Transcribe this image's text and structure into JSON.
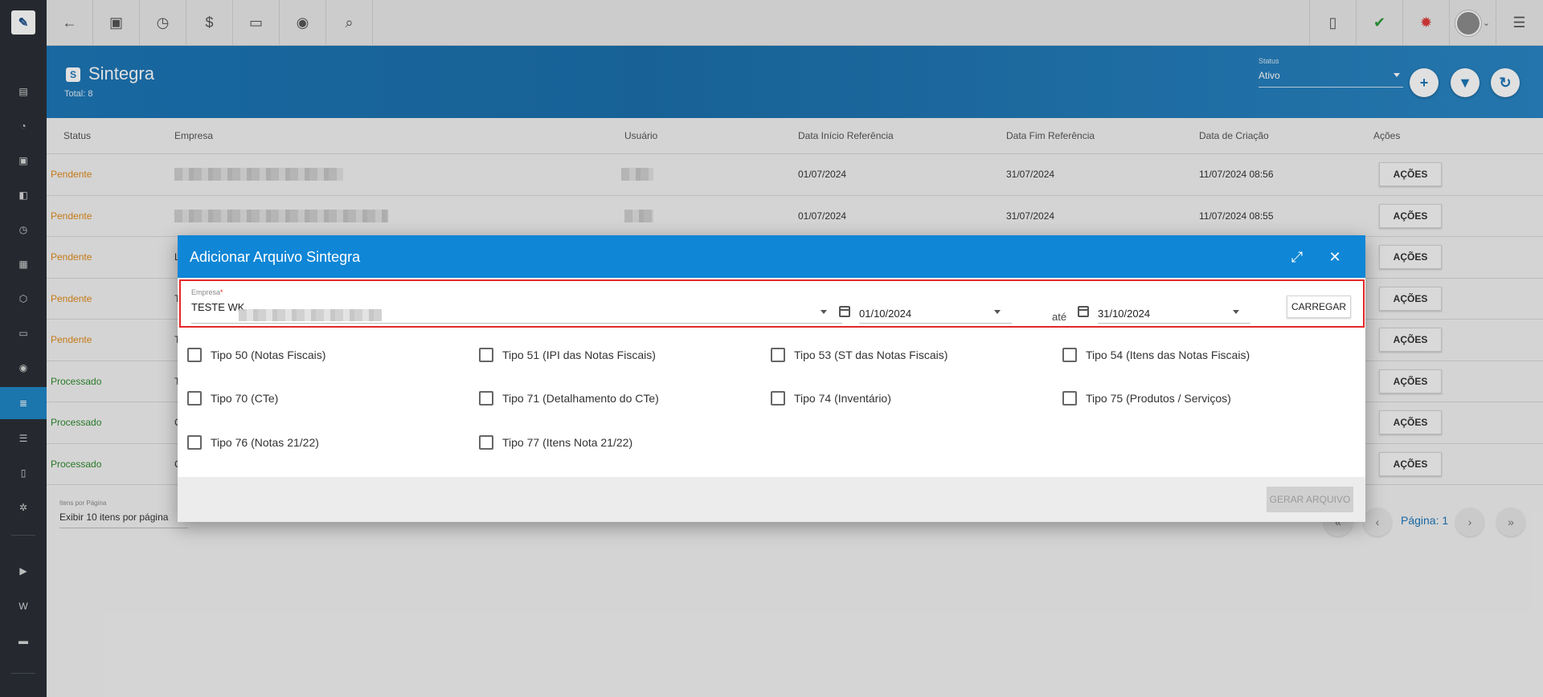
{
  "sidebar": {
    "logo": "✎",
    "items": [
      {
        "icon": "dashboard-icon",
        "glyph": "▤"
      },
      {
        "icon": "chart-icon",
        "glyph": "◔"
      },
      {
        "icon": "contacts-icon",
        "glyph": "▣"
      },
      {
        "icon": "board-icon",
        "glyph": "◧"
      },
      {
        "icon": "calendar-clock-icon",
        "glyph": "◷"
      },
      {
        "icon": "briefcase-icon",
        "glyph": "▦"
      },
      {
        "icon": "box-icon",
        "glyph": "⬡"
      },
      {
        "icon": "money-icon",
        "glyph": "▭"
      },
      {
        "icon": "location-icon",
        "glyph": "◉"
      },
      {
        "icon": "document-icon",
        "glyph": "≣"
      },
      {
        "icon": "stack-icon",
        "glyph": "☰"
      },
      {
        "icon": "file-icon",
        "glyph": "▯"
      },
      {
        "icon": "settings-icon",
        "glyph": "✲"
      },
      {
        "icon": "video-icon",
        "glyph": "▶"
      },
      {
        "icon": "wiki-icon",
        "glyph": "W"
      },
      {
        "icon": "chat-icon",
        "glyph": "▬"
      }
    ]
  },
  "topbar": {
    "back": "←",
    "contacts": "▣",
    "calendar": "◷",
    "money": "$",
    "terminal": "▭",
    "eye": "◉",
    "search": "⌕",
    "pdf": "▯",
    "check": "✔",
    "bell": "✹",
    "menu": "☰",
    "avatar_caret": "⌄"
  },
  "header": {
    "title_icon": "S",
    "title": "Sintegra",
    "total": "Total: 8",
    "status_label": "Status",
    "status_value": "Ativo",
    "add": "+",
    "filter": "▼",
    "refresh": "↻"
  },
  "table": {
    "columns": [
      "Status",
      "Empresa",
      "Usuário",
      "Data Início Referência",
      "Data Fim Referência",
      "Data de Criação",
      "Ações"
    ],
    "rows": [
      {
        "status": "Pendente",
        "kind": "pend",
        "inicio": "01/07/2024",
        "fim": "31/07/2024",
        "criacao": "11/07/2024 08:56",
        "acao": "AÇÕES",
        "empresa_prefix": ""
      },
      {
        "status": "Pendente",
        "kind": "pend",
        "inicio": "01/07/2024",
        "fim": "31/07/2024",
        "criacao": "11/07/2024 08:55",
        "acao": "AÇÕES",
        "empresa_prefix": ""
      },
      {
        "status": "Pendente",
        "kind": "pend",
        "inicio": "",
        "fim": "",
        "criacao": "",
        "acao": "AÇÕES",
        "empresa_prefix": "L"
      },
      {
        "status": "Pendente",
        "kind": "pend",
        "inicio": "",
        "fim": "",
        "criacao": "",
        "acao": "AÇÕES",
        "empresa_prefix": "T"
      },
      {
        "status": "Pendente",
        "kind": "pend",
        "inicio": "",
        "fim": "",
        "criacao": "",
        "acao": "AÇÕES",
        "empresa_prefix": "T"
      },
      {
        "status": "Processado",
        "kind": "proc",
        "inicio": "",
        "fim": "",
        "criacao": "",
        "acao": "AÇÕES",
        "empresa_prefix": "T"
      },
      {
        "status": "Processado",
        "kind": "proc",
        "inicio": "",
        "fim": "",
        "criacao": "",
        "acao": "AÇÕES",
        "empresa_prefix": "C"
      },
      {
        "status": "Processado",
        "kind": "proc",
        "inicio": "",
        "fim": "",
        "criacao": "",
        "acao": "AÇÕES",
        "empresa_prefix": "C"
      }
    ]
  },
  "pagination": {
    "per_page_label": "Itens por Página",
    "per_page_value": "Exibir 10 itens por página",
    "first": "«",
    "prev": "‹",
    "page_text": "Página: 1",
    "next": "›",
    "last": "»"
  },
  "modal": {
    "title": "Adicionar Arquivo Sintegra",
    "expand": "⤢",
    "close": "✕",
    "empresa_label": "Empresa",
    "empresa_required": "*",
    "empresa_value": "TESTE WK",
    "date_start": "01/10/2024",
    "ate": "até",
    "date_end": "31/10/2024",
    "carregar": "CARREGAR",
    "checkboxes": [
      "Tipo 50 (Notas Fiscais)",
      "Tipo 51 (IPI das Notas Fiscais)",
      "Tipo 53 (ST das Notas Fiscais)",
      "Tipo 54 (Itens das Notas Fiscais)",
      "Tipo 70 (CTe)",
      "Tipo 71 (Detalhamento do CTe)",
      "Tipo 74 (Inventário)",
      "Tipo 75 (Produtos / Serviços)",
      "Tipo 76 (Notas 21/22)",
      "Tipo 77 (Itens Nota 21/22)"
    ],
    "gerar": "GERAR ARQUIVO"
  },
  "colors": {
    "brand_blue": "#1d77b8",
    "modal_header": "#0f86d6",
    "pending": "#e08a1a",
    "processed": "#2e8a2e",
    "highlight": "#e52727"
  }
}
